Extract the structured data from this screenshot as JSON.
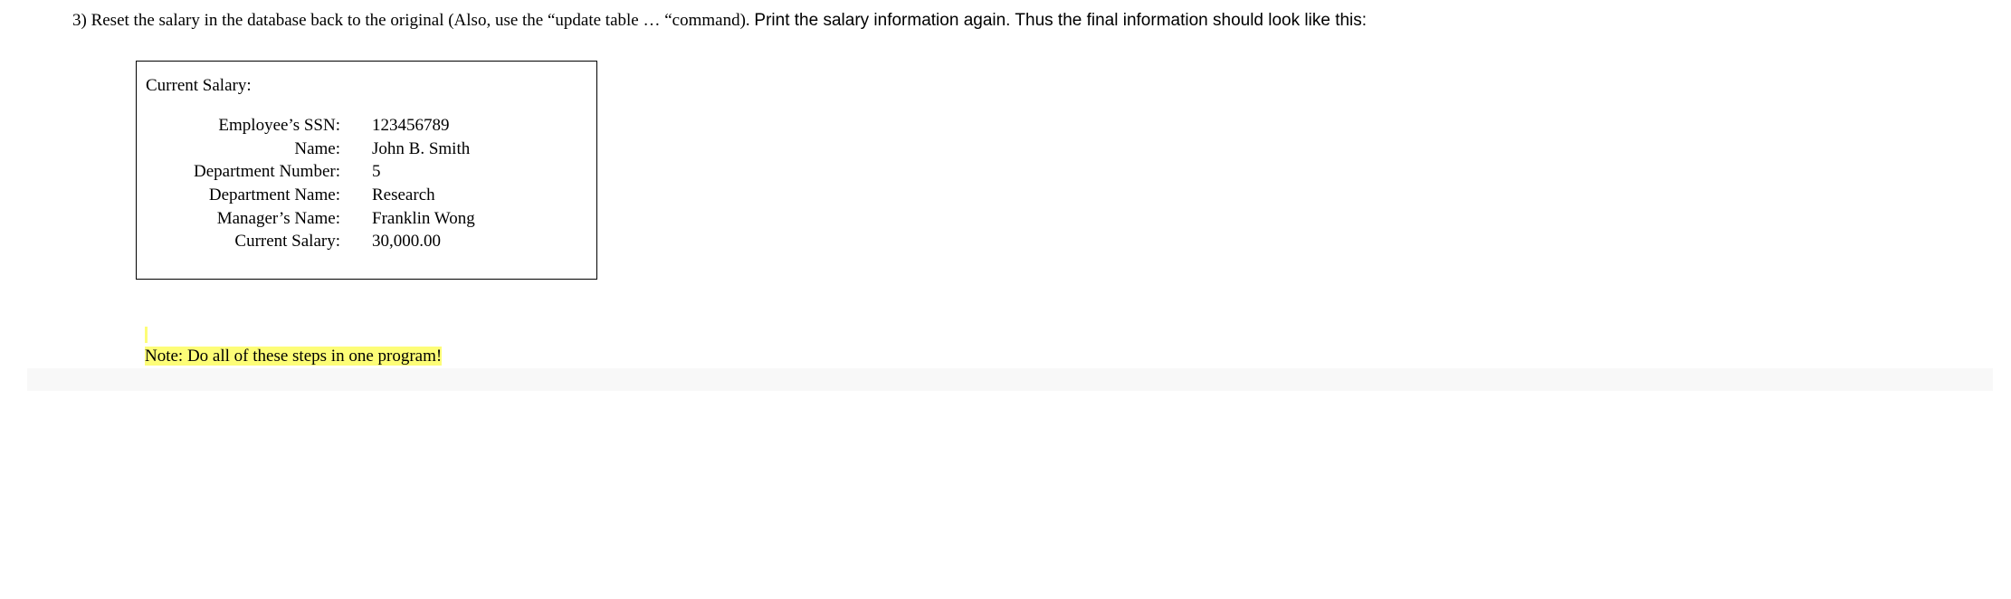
{
  "instruction": {
    "prefix": "3) Reset the salary in the database back to the original (Also, use the “update table … “command). ",
    "suffix": " Print the salary information again.  Thus the final information should look like this:"
  },
  "box": {
    "title": "Current Salary:",
    "rows": [
      {
        "label": "Employee’s SSN:",
        "value": "123456789"
      },
      {
        "label": "Name:",
        "value": "John B.  Smith"
      },
      {
        "label": "Department Number:",
        "value": "5"
      },
      {
        "label": "Department Name:",
        "value": "Research"
      },
      {
        "label": "Manager’s Name:",
        "value": "Franklin Wong"
      },
      {
        "label": "Current Salary:",
        "value": "30,000.00"
      }
    ]
  },
  "note": "Note:  Do all of these steps in one program!"
}
